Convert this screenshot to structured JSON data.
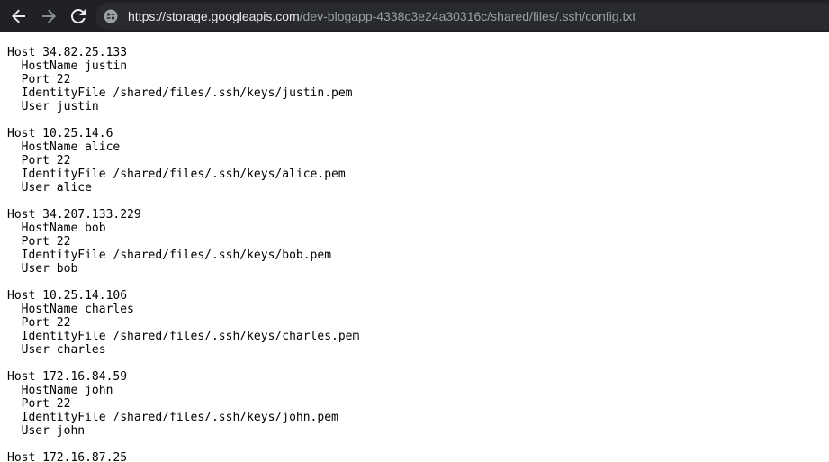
{
  "browser": {
    "url_host": "https://storage.googleapis.com",
    "url_path": "/dev-blogapp-4338c3e24a30316c/shared/files/.ssh/config.txt",
    "nav": {
      "back": "back-arrow-icon",
      "forward": "forward-arrow-icon",
      "reload": "reload-icon",
      "site_info": "site-info-icon"
    },
    "colors": {
      "toolbar_bg": "#202124",
      "omnibox_bg": "#282a2d",
      "url_host": "#e8eaed",
      "url_path": "#9aa0a6"
    }
  },
  "file": {
    "lines": [
      "Host 34.82.25.133",
      "  HostName justin",
      "  Port 22",
      "  IdentityFile /shared/files/.ssh/keys/justin.pem",
      "  User justin",
      "",
      "Host 10.25.14.6",
      "  HostName alice",
      "  Port 22",
      "  IdentityFile /shared/files/.ssh/keys/alice.pem",
      "  User alice",
      "",
      "Host 34.207.133.229",
      "  HostName bob",
      "  Port 22",
      "  IdentityFile /shared/files/.ssh/keys/bob.pem",
      "  User bob",
      "",
      "Host 10.25.14.106",
      "  HostName charles",
      "  Port 22",
      "  IdentityFile /shared/files/.ssh/keys/charles.pem",
      "  User charles",
      "",
      "Host 172.16.84.59",
      "  HostName john",
      "  Port 22",
      "  IdentityFile /shared/files/.ssh/keys/john.pem",
      "  User john",
      "",
      "Host 172.16.87.25"
    ]
  }
}
